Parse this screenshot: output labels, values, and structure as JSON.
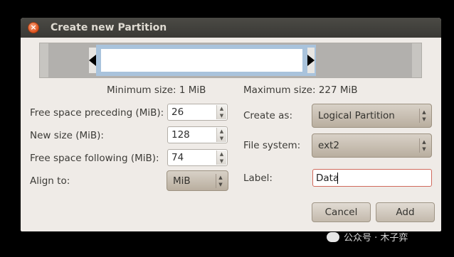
{
  "window": {
    "title": "Create new Partition",
    "close_glyph": "×"
  },
  "resizer": {
    "min_label": "Minimum size: 1 MiB",
    "max_label": "Maximum size: 227 MiB"
  },
  "left_fields": {
    "free_preceding": {
      "label": "Free space preceding (MiB):",
      "value": "26"
    },
    "new_size": {
      "label": "New size (MiB):",
      "value": "128"
    },
    "free_following": {
      "label": "Free space following (MiB):",
      "value": "74"
    },
    "align": {
      "label": "Align to:",
      "value": "MiB"
    }
  },
  "right_fields": {
    "create_as": {
      "label": "Create as:",
      "value": "Logical Partition"
    },
    "file_system": {
      "label": "File system:",
      "value": "ext2"
    },
    "label": {
      "label": "Label:",
      "value": "Data"
    }
  },
  "buttons": {
    "cancel": "Cancel",
    "add": "Add"
  },
  "spin_arrows": {
    "up": "▲",
    "down": "▼"
  },
  "watermark": {
    "text": "公众号 · 木子弈"
  },
  "colors": {
    "titlebar": "#3f3e3a",
    "dialog_bg": "#efebe7",
    "partition_selected": "#a9c3dc",
    "close_button": "#e0521c"
  }
}
